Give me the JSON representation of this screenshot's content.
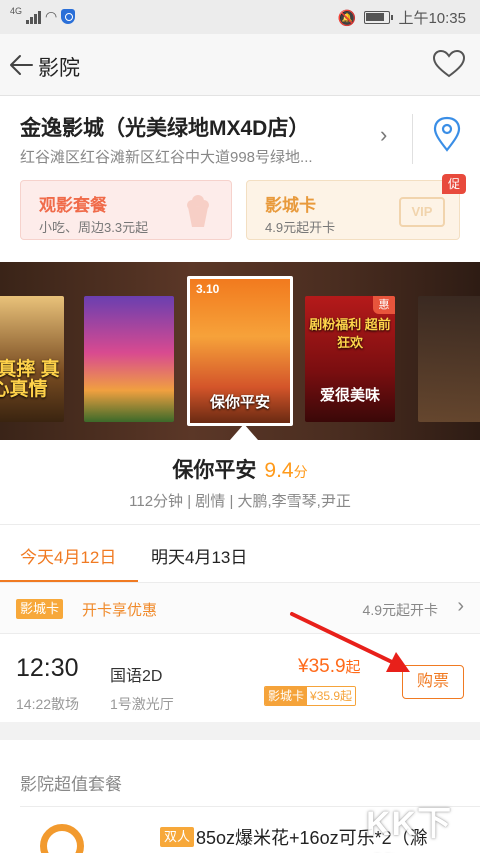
{
  "status_bar": {
    "network": "4G",
    "time": "上午10:35"
  },
  "nav": {
    "title": "影院"
  },
  "cinema": {
    "name": "金逸影城（光美绿地MX4D店）",
    "address": "红谷滩区红谷滩新区红谷中大道998号绿地..."
  },
  "cards": {
    "food": {
      "title": "观影套餐",
      "subtitle": "小吃、周边3.3元起"
    },
    "vip": {
      "title": "影城卡",
      "subtitle": "4.9元起开卡",
      "badge": "促",
      "image_text": "VIP"
    }
  },
  "posters": {
    "p1_title": "打真摔 真心真情",
    "p3_date": "3.10",
    "p3_title": "保你平安",
    "p4_title": "剧粉福利 超前狂欢",
    "p4_subtitle": "爱很美味",
    "p4_badge": "惠"
  },
  "movie": {
    "name": "保你平安",
    "score": "9.4",
    "score_unit": "分",
    "meta": "112分钟 | 剧情 | 大鹏,李雪琴,尹正"
  },
  "dates": {
    "today": "今天4月12日",
    "tomorrow": "明天4月13日"
  },
  "card_bar": {
    "tag": "影城卡",
    "offer": "开卡享优惠",
    "price": "4.9元起开卡"
  },
  "showtime": {
    "time": "12:30",
    "end": "14:22散场",
    "language": "国语2D",
    "hall": "1号激光厅",
    "price": "¥35.9",
    "price_suffix": "起",
    "vip_tag": "影城卡",
    "vip_price": "¥35.9起",
    "buy_label": "购票"
  },
  "combo": {
    "heading": "影院超值套餐",
    "tag": "双人",
    "name": "85oz爆米花+16oz可乐*2（滁"
  },
  "watermark": "KK下载",
  "colors": {
    "accent": "#f07a22",
    "price": "#ff6a1a",
    "annotation_arrow": "#e8201a"
  }
}
